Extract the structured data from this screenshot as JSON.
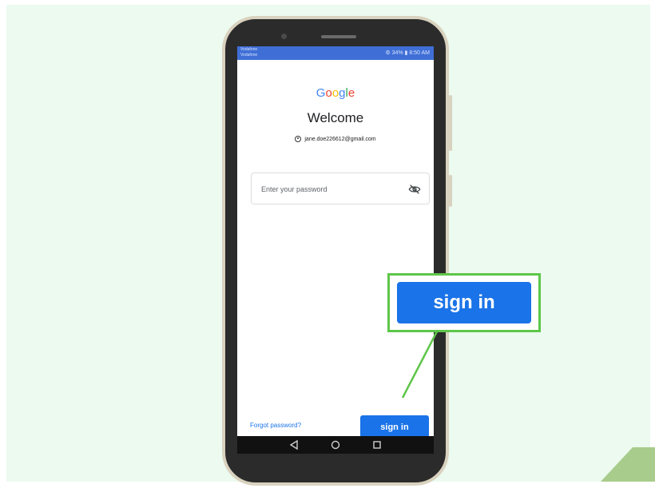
{
  "status_bar": {
    "carrier_line1": "Vodafone",
    "carrier_line2": "Vodafone",
    "right": "⚙ 34% ▮ 8:50 AM"
  },
  "brand": {
    "letters": [
      "G",
      "o",
      "o",
      "g",
      "l",
      "e"
    ],
    "colors": [
      "#4285f4",
      "#ea4335",
      "#fbbc05",
      "#4285f4",
      "#34a853",
      "#ea4335"
    ]
  },
  "welcome_title": "Welcome",
  "account_email": "jane.doe226612@gmail.com",
  "password": {
    "placeholder": "Enter your password",
    "value": ""
  },
  "forgot_password_label": "Forgot password?",
  "sign_in_label": "sign in",
  "callout": {
    "label": "sign in"
  },
  "icons": {
    "visibility": "eye-off-icon",
    "nav_back": "back-triangle-icon",
    "nav_home": "home-circle-icon",
    "nav_recents": "recents-square-icon",
    "account": "account-circle-icon"
  },
  "colors": {
    "primary": "#1a73e8",
    "highlight": "#5ec64a",
    "background": "#ecfaef",
    "status_bar": "#3f6fd6"
  }
}
